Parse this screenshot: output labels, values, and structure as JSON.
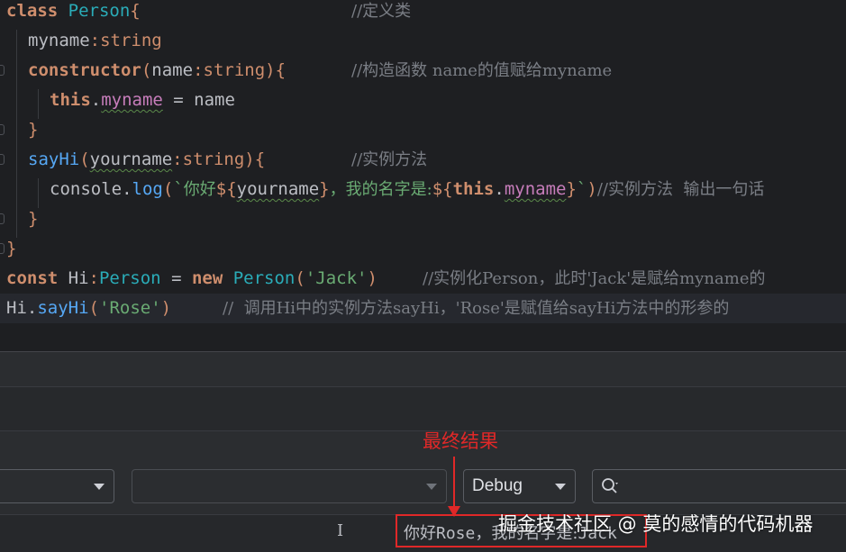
{
  "code": {
    "l1": {
      "kw": "class ",
      "cls": "Person",
      "brace": "{",
      "comment": "//定义类"
    },
    "l2": {
      "prop": "myname",
      "colon": ":",
      "type": "string"
    },
    "l3": {
      "kw": "constructor",
      "p1": "(",
      "param": "name",
      "colon": ":",
      "type": "string",
      "p2": "){",
      "comment": "//构造函数 name的值赋给myname"
    },
    "l4": {
      "kw": "this",
      "dot": ".",
      "prop": "myname",
      "rest": " = name"
    },
    "l5": {
      "brace": "}"
    },
    "l6": {
      "fn": "sayHi",
      "p1": "(",
      "param": "yourname",
      "colon": ":",
      "type": "string",
      "p2": "){",
      "comment": "//实例方法"
    },
    "l7": {
      "obj": "console",
      "dot": ".",
      "fn": "log",
      "p1": "(",
      "tick": "`",
      "zh1": "你好",
      "d1": "${",
      "v1": "yourname",
      "d2": "}",
      "zh2": "，我的名字是:",
      "d3": "${",
      "kw": "this",
      "dot2": ".",
      "v2": "myname",
      "d4": "}",
      "tick2": "`",
      "p2": ")",
      "comment": "//实例方法  输出一句话"
    },
    "l8": {
      "brace": "}"
    },
    "l9": {
      "brace": "}"
    },
    "l10": {
      "kw": "const ",
      "name": "Hi",
      "colon": ":",
      "type": "Person",
      "eq": " = ",
      "kw2": "new ",
      "cls": "Person",
      "p1": "(",
      "str": "'Jack'",
      "p2": ")",
      "comment": "//实例化Person，此时'Jack'是赋给myname的"
    },
    "l11": {
      "obj": "Hi",
      "dot": ".",
      "fn": "sayHi",
      "p1": "(",
      "str": "'Rose'",
      "p2": ")",
      "comment": "//  调用Hi中的实例方法sayHi，'Rose'是赋值给sayHi方法中的形参的"
    }
  },
  "toolbar": {
    "debug_select": "Debug",
    "search_placeholder": ""
  },
  "annotation": {
    "label": "最终结果",
    "color": "#e02828"
  },
  "output": {
    "zh_a": "你好",
    "name_a": "Rose",
    "zh_b": "，我的名字是:",
    "name_b": "Jack"
  },
  "status": {
    "cursor_glyph": "I"
  },
  "watermark": "掘金技术社区 @ 莫的感情的代码机器"
}
